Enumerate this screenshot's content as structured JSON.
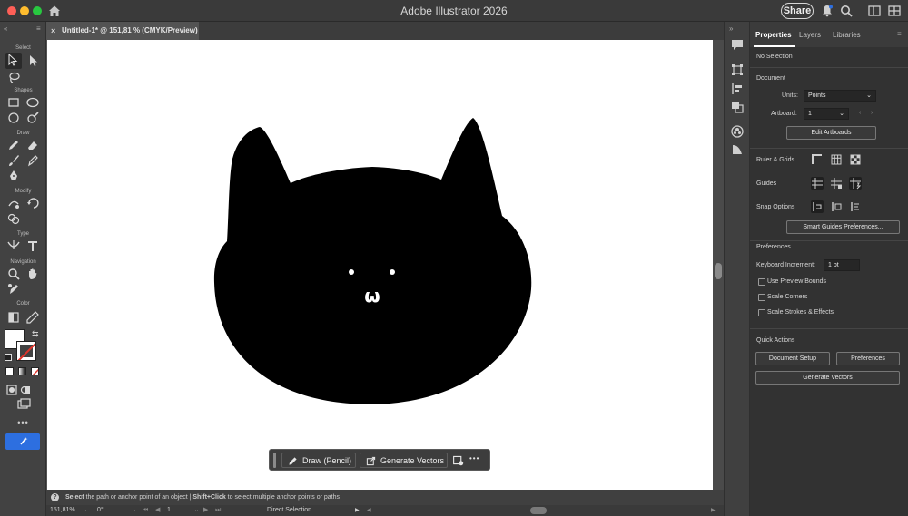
{
  "window": {
    "title": "Adobe Illustrator 2026",
    "share_label": "Share"
  },
  "toolbar": {
    "sections": [
      "Select",
      "Shapes",
      "Draw",
      "Modify",
      "Type",
      "Navigation",
      "Color"
    ]
  },
  "document": {
    "tab_title": "Untitled-1* @ 151,81 % (CMYK/Preview)",
    "close_glyph": "×"
  },
  "artwork": {
    "subject": "black cat face",
    "fill_color": "#000000",
    "mouth_glyph": "ω"
  },
  "context_bar": {
    "draw_label": "Draw (Pencil)",
    "generate_label": "Generate Vectors",
    "more_glyph": "•••"
  },
  "hint": {
    "part1": "Select",
    "part2": " the path or anchor point of an object  |  ",
    "part3": "Shift+Click",
    "part4": " to select multiple anchor points or paths"
  },
  "status": {
    "zoom": "151,81%",
    "rotation": "0°",
    "artboard_num": "1",
    "current_tool": "Direct Selection"
  },
  "panel": {
    "tabs": [
      "Properties",
      "Layers",
      "Libraries"
    ],
    "selection_text": "No Selection",
    "document_heading": "Document",
    "units_label": "Units:",
    "units_value": "Points",
    "artboard_label": "Artboard:",
    "artboard_value": "1",
    "edit_artboards": "Edit Artboards",
    "ruler_grids": "Ruler & Grids",
    "guides": "Guides",
    "snap_options": "Snap Options",
    "smart_guides_prefs": "Smart Guides Preferences...",
    "preferences_heading": "Preferences",
    "keyboard_increment_label": "Keyboard Increment:",
    "keyboard_increment_value": "1 pt",
    "use_preview_bounds": "Use Preview Bounds",
    "scale_corners": "Scale Corners",
    "scale_strokes": "Scale Strokes & Effects",
    "quick_actions_heading": "Quick Actions",
    "document_setup": "Document Setup",
    "preferences_btn": "Preferences",
    "generate_vectors": "Generate Vectors"
  },
  "colors": {
    "accent_blue": "#2d6fe0",
    "traffic_close": "#fe5f57",
    "traffic_min": "#febc2e",
    "traffic_max": "#28c840"
  }
}
